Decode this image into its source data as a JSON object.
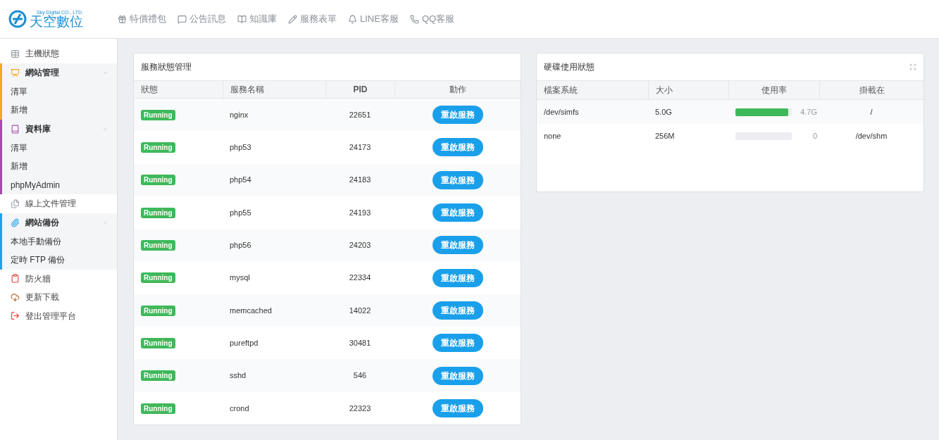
{
  "logo": {
    "tagline": "Sky Digital CO., LTD.",
    "name": "天空數位"
  },
  "top_nav": [
    "特價禮包",
    "公告訊息",
    "知識庫",
    "服務表單",
    "LINE客服",
    "QQ客服"
  ],
  "sidebar": [
    {
      "kind": "item",
      "label": "主機狀態"
    },
    {
      "kind": "group",
      "label": "網站管理",
      "color": "#f5a623",
      "expanded": true,
      "children": [
        "清單",
        "新增"
      ]
    },
    {
      "kind": "group",
      "label": "資料庫",
      "color": "#a54ba8",
      "expanded": true,
      "children": [
        "清單",
        "新增",
        "phpMyAdmin"
      ]
    },
    {
      "kind": "item",
      "label": "線上文件管理"
    },
    {
      "kind": "group",
      "label": "網站備份",
      "color": "#1ea1f2",
      "expanded": true,
      "children": [
        "本地手動備份",
        "定時 FTP 備份"
      ]
    },
    {
      "kind": "item",
      "label": "防火牆"
    },
    {
      "kind": "item",
      "label": "更新下載"
    },
    {
      "kind": "item",
      "label": "登出管理平台"
    }
  ],
  "services": {
    "title": "服務狀態管理",
    "columns": [
      "狀態",
      "服務名稱",
      "PID",
      "動作"
    ],
    "rows": [
      {
        "status": "Running",
        "name": "nginx",
        "pid": "22651",
        "action": "重啟服務"
      },
      {
        "status": "Running",
        "name": "php53",
        "pid": "24173",
        "action": "重啟服務"
      },
      {
        "status": "Running",
        "name": "php54",
        "pid": "24183",
        "action": "重啟服務"
      },
      {
        "status": "Running",
        "name": "php55",
        "pid": "24193",
        "action": "重啟服務"
      },
      {
        "status": "Running",
        "name": "php56",
        "pid": "24203",
        "action": "重啟服務"
      },
      {
        "status": "Running",
        "name": "mysql",
        "pid": "22334",
        "action": "重啟服務"
      },
      {
        "status": "Running",
        "name": "memcached",
        "pid": "14022",
        "action": "重啟服務"
      },
      {
        "status": "Running",
        "name": "pureftpd",
        "pid": "30481",
        "action": "重啟服務"
      },
      {
        "status": "Running",
        "name": "sshd",
        "pid": "546",
        "action": "重啟服務"
      },
      {
        "status": "Running",
        "name": "crond",
        "pid": "22323",
        "action": "重啟服務"
      }
    ]
  },
  "disk": {
    "title": "硬碟使用狀態",
    "columns": [
      "檔案系統",
      "大小",
      "使用率",
      "掛載在"
    ],
    "rows": [
      {
        "filesystem": "/dev/simfs",
        "size": "5.0G",
        "level": 0.94,
        "used": "4.7G",
        "mount": "/"
      },
      {
        "filesystem": "none",
        "size": "256M",
        "level": 0,
        "used": "0",
        "mount": "/dev/shm"
      }
    ]
  }
}
